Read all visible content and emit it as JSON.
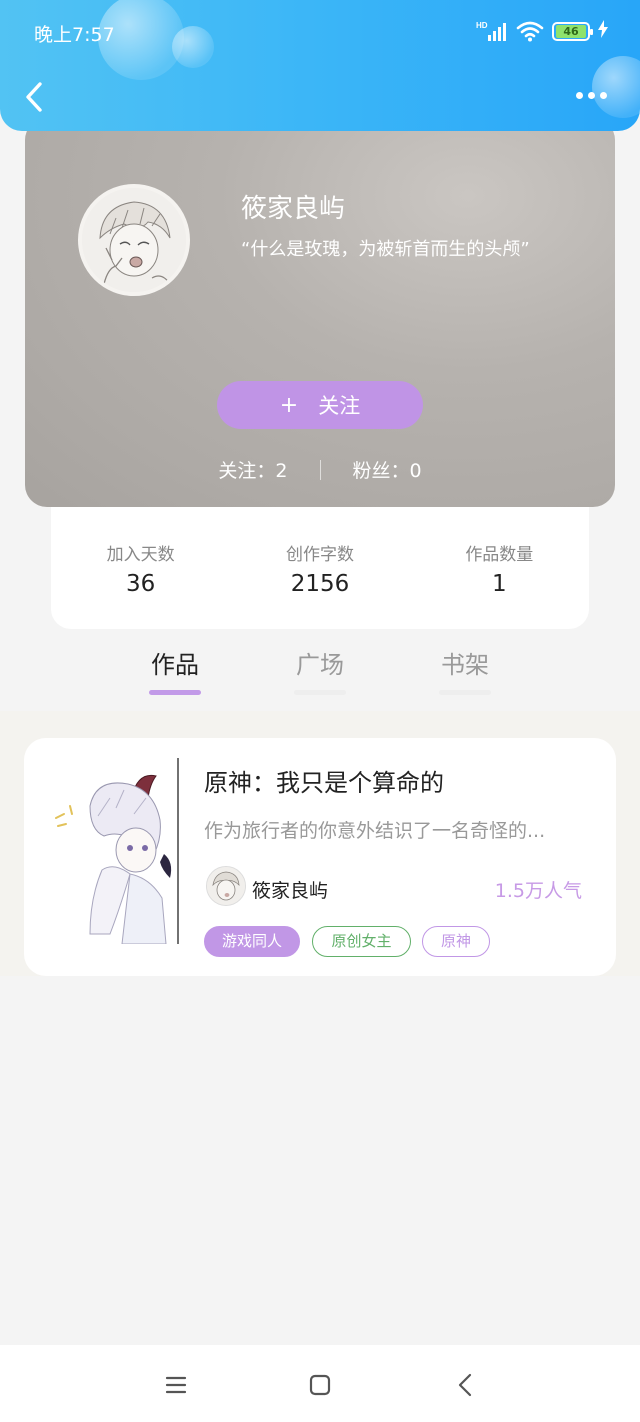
{
  "status_bar": {
    "time": "晚上7:57",
    "network_label": "HD",
    "battery_level": "46",
    "colors": {
      "header_gradient_start": "#52c3f3",
      "header_gradient_end": "#28a6f8"
    },
    "icons": [
      "signal-icon",
      "wifi-icon",
      "battery-icon",
      "charging-icon"
    ]
  },
  "nav": {
    "icons": [
      "back-icon",
      "more-icon"
    ]
  },
  "profile": {
    "name": "筱家良屿",
    "motto": "“什么是玫瑰，为被斩首而生的头颅”",
    "follow_plus": "+",
    "follow_label": "关注",
    "following_text": "关注：2",
    "followers_text": "粉丝：0",
    "accent_color": "#c094e6"
  },
  "stats": [
    {
      "label": "加入天数",
      "value": "36"
    },
    {
      "label": "创作字数",
      "value": "2156"
    },
    {
      "label": "作品数量",
      "value": "1"
    }
  ],
  "tabs": [
    {
      "label": "作品",
      "active": true
    },
    {
      "label": "广场",
      "active": false
    },
    {
      "label": "书架",
      "active": false
    }
  ],
  "works": [
    {
      "title": "原神：我只是个算命的",
      "description": "作为旅行者的你意外结识了一名奇怪的...",
      "author": "筱家良屿",
      "popularity": "1.5万人气",
      "tags": [
        "游戏同人",
        "原创女主",
        "原神"
      ]
    }
  ],
  "system_nav": {
    "icons": [
      "menu-icon",
      "home-icon",
      "back-nav-icon"
    ]
  }
}
